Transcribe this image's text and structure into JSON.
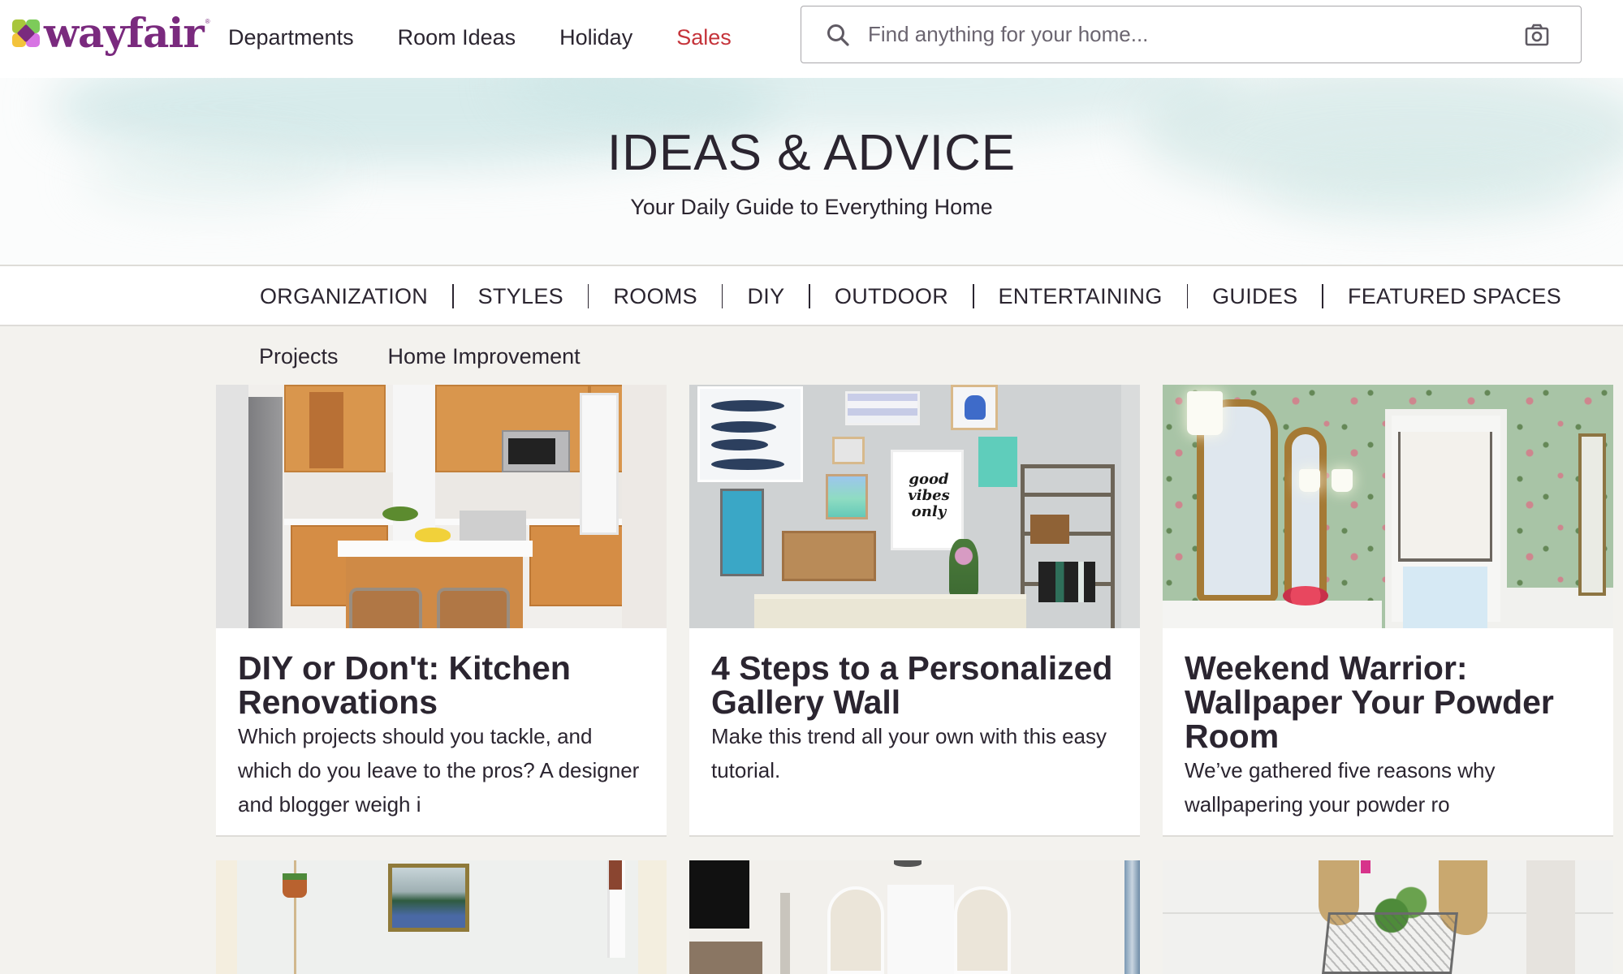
{
  "header": {
    "logo_text": "wayfair",
    "logo_registered": "®",
    "nav": [
      {
        "label": "Departments"
      },
      {
        "label": "Room Ideas"
      },
      {
        "label": "Holiday"
      },
      {
        "label": "Sales",
        "highlight_color": "#c5333a"
      }
    ],
    "search": {
      "placeholder": "Find anything for your home...",
      "value": "",
      "search_icon": "search-icon",
      "camera_icon": "camera-icon"
    }
  },
  "hero": {
    "title": "IDEAS & ADVICE",
    "subtitle": "Your Daily Guide to Everything Home"
  },
  "category_nav": {
    "items": [
      {
        "label": "ORGANIZATION"
      },
      {
        "label": "STYLES"
      },
      {
        "label": "ROOMS"
      },
      {
        "label": "DIY"
      },
      {
        "label": "OUTDOOR"
      },
      {
        "label": "ENTERTAINING"
      },
      {
        "label": "GUIDES"
      },
      {
        "label": "FEATURED SPACES"
      }
    ]
  },
  "sub_tabs": [
    {
      "label": "Projects"
    },
    {
      "label": "Home Improvement"
    }
  ],
  "articles": [
    {
      "title": "DIY or Don't: Kitchen Renovations",
      "description": "Which projects should you tackle, and which do you leave to the pros? A designer and blogger weigh i",
      "image": "kitchen-photo"
    },
    {
      "title": "4 Steps to a Personalized Gallery Wall",
      "description": "Make this trend all your own with this easy tutorial.",
      "image": "gallery-wall-photo"
    },
    {
      "title": "Weekend Warrior: Wallpaper Your Powder Room",
      "description": "We’ve gathered five reasons why wallpapering your powder ro",
      "image": "powder-room-photo"
    },
    {
      "image": "macrame-wall-photo"
    },
    {
      "image": "living-room-shelves-photo"
    },
    {
      "image": "terrarium-photo"
    }
  ],
  "colors": {
    "brand_purple": "#7a2a7e",
    "sales_red": "#c5333a",
    "text": "#2b2530",
    "page_bg": "#f3f2ee"
  }
}
